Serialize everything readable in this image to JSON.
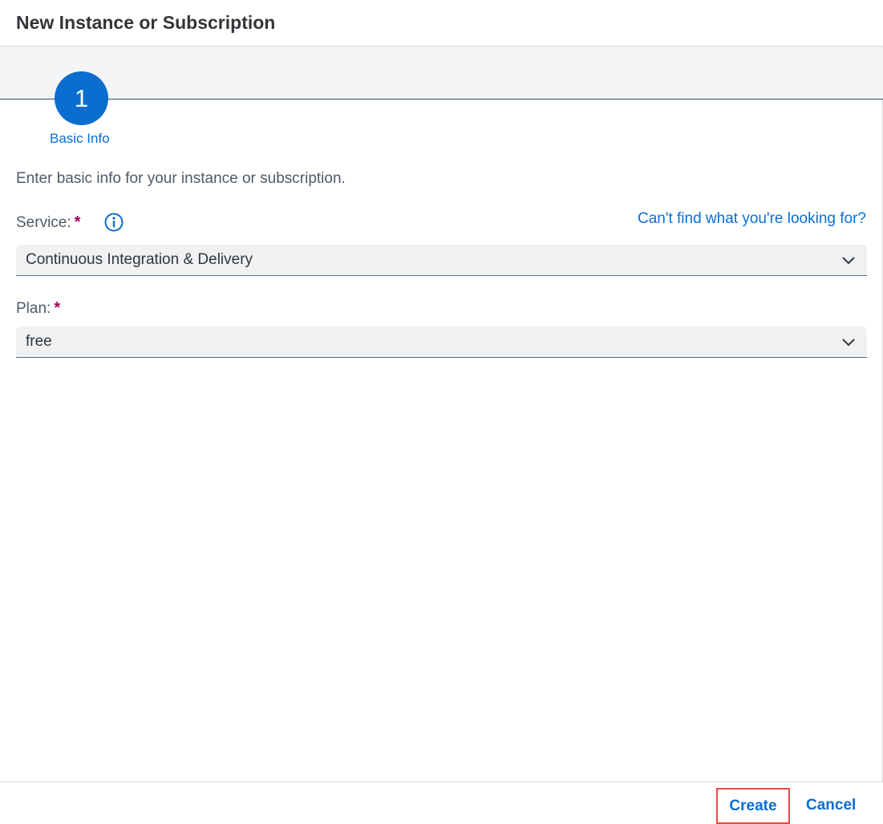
{
  "dialog": {
    "title": "New Instance or Subscription"
  },
  "wizard": {
    "step_number": "1",
    "step_label": "Basic Info"
  },
  "form": {
    "intro": "Enter basic info for your instance or subscription.",
    "service_label": "Service:",
    "plan_label": "Plan:",
    "required_marker": "*",
    "help_link": "Can't find what you're looking for?",
    "service_value": "Continuous Integration & Delivery",
    "plan_value": "free"
  },
  "footer": {
    "create_label": "Create",
    "cancel_label": "Cancel"
  },
  "icons": {
    "info": "info-icon",
    "dropdown": "chevron-down-icon"
  },
  "colors": {
    "accent": "#0a6ed1",
    "required": "#a0005a",
    "highlight": "#e24b4b"
  }
}
